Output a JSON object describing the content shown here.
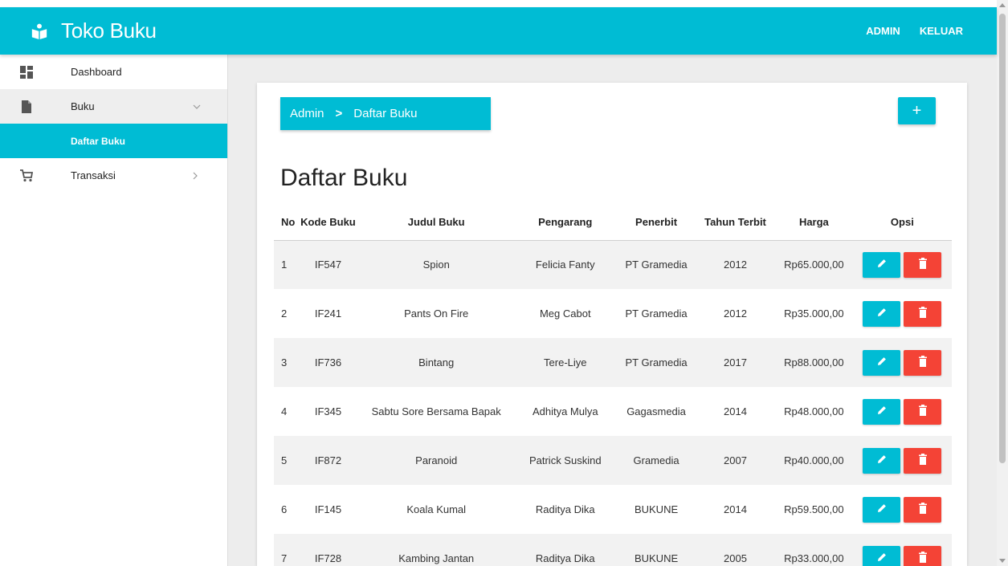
{
  "app": {
    "name": "Toko Buku"
  },
  "header_nav": {
    "admin": "ADMIN",
    "logout": "KELUAR"
  },
  "sidebar": {
    "items": [
      {
        "label": "Dashboard",
        "icon": "dashboard-icon"
      },
      {
        "label": "Buku",
        "icon": "file-icon",
        "caret": "chevron-down-icon"
      },
      {
        "label": "Daftar Buku"
      },
      {
        "label": "Transaksi",
        "icon": "cart-icon",
        "caret": "chevron-right-icon"
      }
    ]
  },
  "breadcrumb": {
    "root": "Admin",
    "separator": ">",
    "current": "Daftar Buku"
  },
  "add_button": {
    "label": "+"
  },
  "page_title": "Daftar Buku",
  "table": {
    "headers": [
      "No",
      "Kode Buku",
      "Judul Buku",
      "Pengarang",
      "Penerbit",
      "Tahun Terbit",
      "Harga",
      "Opsi"
    ],
    "rows": [
      {
        "no": "1",
        "kode": "IF547",
        "judul": "Spion",
        "pengarang": "Felicia Fanty",
        "penerbit": "PT Gramedia",
        "tahun": "2012",
        "harga": "Rp65.000,00"
      },
      {
        "no": "2",
        "kode": "IF241",
        "judul": "Pants On Fire",
        "pengarang": "Meg Cabot",
        "penerbit": "PT Gramedia",
        "tahun": "2012",
        "harga": "Rp35.000,00"
      },
      {
        "no": "3",
        "kode": "IF736",
        "judul": "Bintang",
        "pengarang": "Tere-Liye",
        "penerbit": "PT Gramedia",
        "tahun": "2017",
        "harga": "Rp88.000,00"
      },
      {
        "no": "4",
        "kode": "IF345",
        "judul": "Sabtu Sore Bersama Bapak",
        "pengarang": "Adhitya Mulya",
        "penerbit": "Gagasmedia",
        "tahun": "2014",
        "harga": "Rp48.000,00"
      },
      {
        "no": "5",
        "kode": "IF872",
        "judul": "Paranoid",
        "pengarang": "Patrick Suskind",
        "penerbit": "Gramedia",
        "tahun": "2007",
        "harga": "Rp40.000,00"
      },
      {
        "no": "6",
        "kode": "IF145",
        "judul": "Koala Kumal",
        "pengarang": "Raditya Dika",
        "penerbit": "BUKUNE",
        "tahun": "2014",
        "harga": "Rp59.500,00"
      },
      {
        "no": "7",
        "kode": "IF728",
        "judul": "Kambing Jantan",
        "pengarang": "Raditya Dika",
        "penerbit": "BUKUNE",
        "tahun": "2005",
        "harga": "Rp33.000,00"
      }
    ]
  },
  "colors": {
    "primary": "#00bcd4",
    "danger": "#f44336",
    "background": "#ededed"
  }
}
